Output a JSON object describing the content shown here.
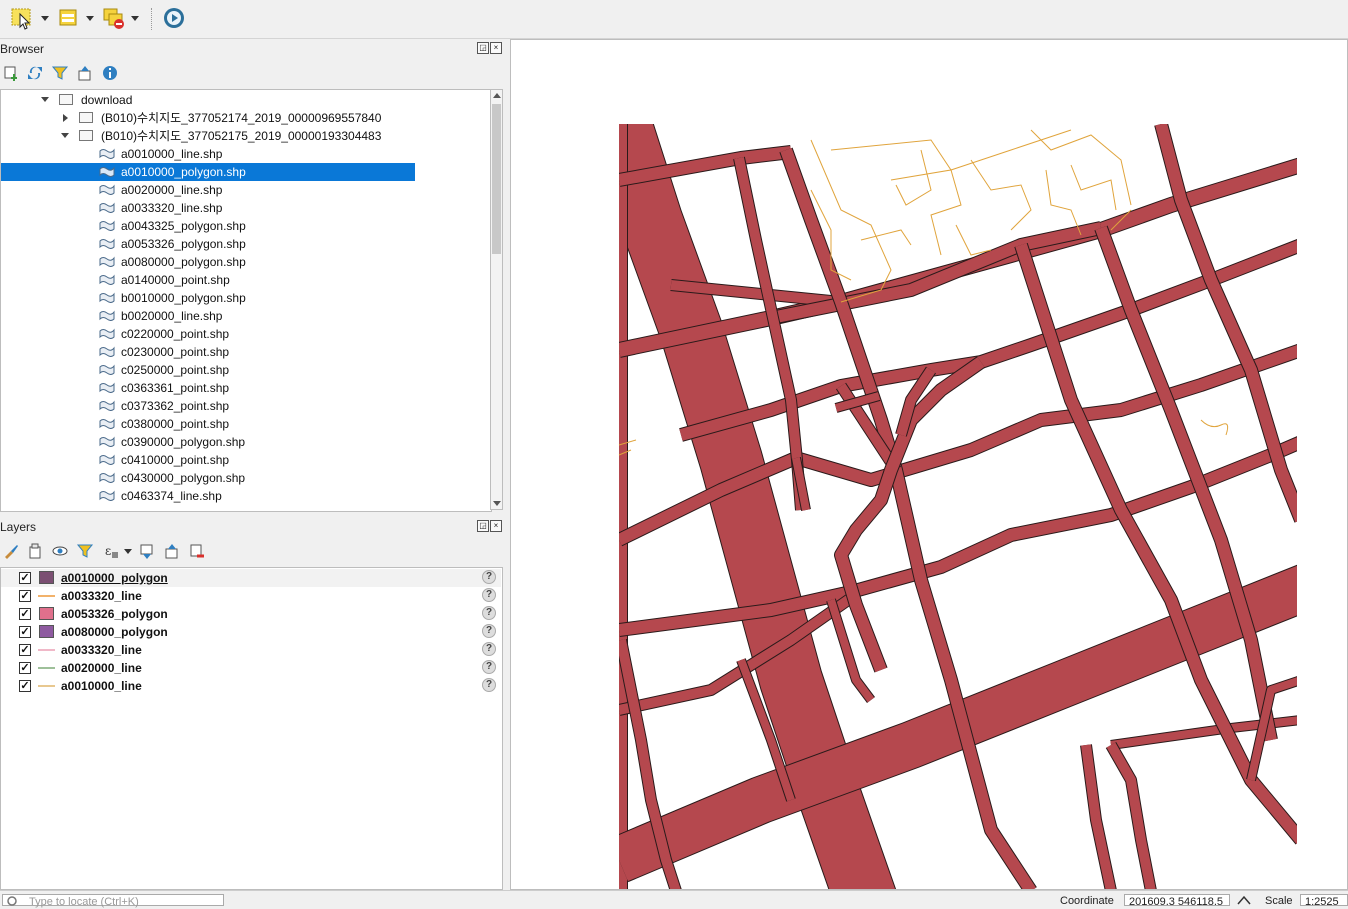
{
  "toolbar": {
    "buttons": [
      {
        "icon": "select-features-icon"
      },
      {
        "icon": "open-attribute-table-icon"
      },
      {
        "icon": "deselect-features-icon"
      },
      {
        "icon": "temporal-controller-icon"
      }
    ]
  },
  "browser": {
    "title": "Browser",
    "items": [
      {
        "label": "download",
        "type": "folder",
        "depth": 0,
        "expanded": true
      },
      {
        "label": "(B010)수치지도_377052174_2019_00000969557840",
        "type": "folder",
        "depth": 1,
        "expanded": false
      },
      {
        "label": "(B010)수치지도_377052175_2019_00000193304483",
        "type": "folder",
        "depth": 1,
        "expanded": true
      },
      {
        "label": "a0010000_line.shp",
        "type": "shp",
        "depth": 2
      },
      {
        "label": "a0010000_polygon.shp",
        "type": "shp",
        "depth": 2,
        "selected": true
      },
      {
        "label": "a0020000_line.shp",
        "type": "shp",
        "depth": 2
      },
      {
        "label": "a0033320_line.shp",
        "type": "shp",
        "depth": 2
      },
      {
        "label": "a0043325_polygon.shp",
        "type": "shp",
        "depth": 2
      },
      {
        "label": "a0053326_polygon.shp",
        "type": "shp",
        "depth": 2
      },
      {
        "label": "a0080000_polygon.shp",
        "type": "shp",
        "depth": 2
      },
      {
        "label": "a0140000_point.shp",
        "type": "shp",
        "depth": 2
      },
      {
        "label": "b0010000_polygon.shp",
        "type": "shp",
        "depth": 2
      },
      {
        "label": "b0020000_line.shp",
        "type": "shp",
        "depth": 2
      },
      {
        "label": "c0220000_point.shp",
        "type": "shp",
        "depth": 2
      },
      {
        "label": "c0230000_point.shp",
        "type": "shp",
        "depth": 2
      },
      {
        "label": "c0250000_point.shp",
        "type": "shp",
        "depth": 2
      },
      {
        "label": "c0363361_point.shp",
        "type": "shp",
        "depth": 2
      },
      {
        "label": "c0373362_point.shp",
        "type": "shp",
        "depth": 2
      },
      {
        "label": "c0380000_point.shp",
        "type": "shp",
        "depth": 2
      },
      {
        "label": "c0390000_polygon.shp",
        "type": "shp",
        "depth": 2
      },
      {
        "label": "c0410000_point.shp",
        "type": "shp",
        "depth": 2
      },
      {
        "label": "c0430000_polygon.shp",
        "type": "shp",
        "depth": 2
      },
      {
        "label": "c0463374_line.shp",
        "type": "shp",
        "depth": 2
      }
    ]
  },
  "layers": {
    "title": "Layers",
    "items": [
      {
        "name": "a0010000_polygon",
        "kind": "polygon",
        "color": "#7b4f72",
        "checked": true,
        "current": true
      },
      {
        "name": "a0033320_line",
        "kind": "line",
        "color": "#f2b26b",
        "checked": true
      },
      {
        "name": "a0053326_polygon",
        "kind": "polygon",
        "color": "#e0708c",
        "checked": true
      },
      {
        "name": "a0080000_polygon",
        "kind": "polygon",
        "color": "#8e5aa0",
        "checked": true
      },
      {
        "name": "a0033320_line",
        "kind": "line",
        "color": "#f0b8c8",
        "checked": true
      },
      {
        "name": "a0020000_line",
        "kind": "line",
        "color": "#9ec09a",
        "checked": true
      },
      {
        "name": "a0010000_line",
        "kind": "line",
        "color": "#e8c890",
        "checked": true
      }
    ]
  },
  "map": {
    "road_color": "#b5484e",
    "building_line_color": "#e0a43c"
  },
  "status": {
    "locator_placeholder": "Type to locate (Ctrl+K)",
    "coordinate_label": "Coordinate",
    "coordinate_value": "201609,3 546118,5",
    "scale_label": "Scale",
    "scale_value": "1:2525"
  }
}
